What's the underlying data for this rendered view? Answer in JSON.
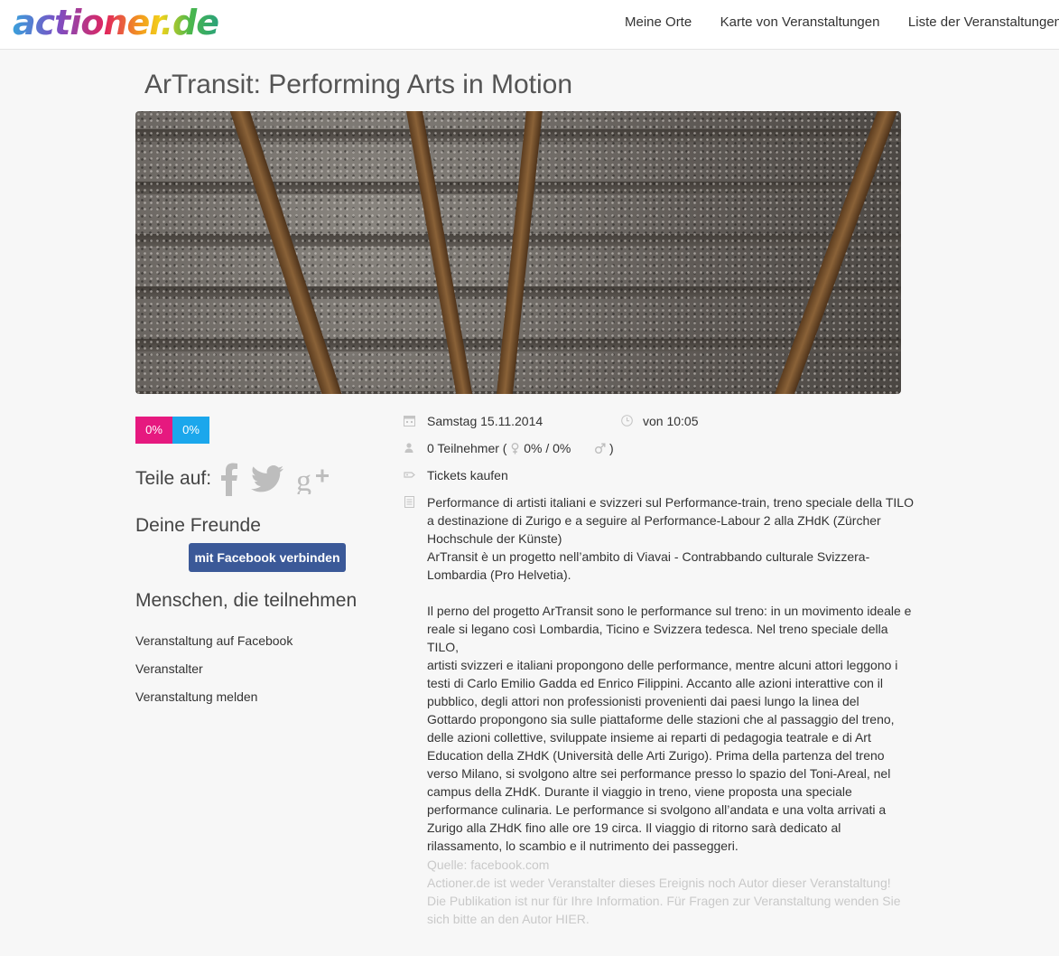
{
  "header": {
    "logo_text": "actioner.de",
    "nav": [
      "Meine Orte",
      "Karte von Veranstaltungen",
      "Liste der Veranstaltungen"
    ]
  },
  "event": {
    "title": "ArTransit: Performing Arts in Motion",
    "date": "Samstag 15.11.2014",
    "time": "von 10:05",
    "participants_count": "0 Teilnehmer (",
    "gender_ratio": "0% / 0%",
    "participants_close": ")",
    "tickets_label": "Tickets kaufen"
  },
  "stats": {
    "female_percent": "0%",
    "male_percent": "0%"
  },
  "share": {
    "label": "Teile auf:",
    "icons": [
      "facebook-icon",
      "twitter-icon",
      "google-plus-icon"
    ]
  },
  "friends": {
    "heading": "Deine Freunde",
    "connect_button": "mit Facebook verbinden"
  },
  "people_heading": "Menschen, die teilnehmen",
  "links": [
    "Veranstaltung auf Facebook",
    "Veranstalter",
    "Veranstaltung melden"
  ],
  "description": {
    "paragraph1_lines": [
      "Performance di artisti italiani e svizzeri sul Performance-train, treno speciale della TILO",
      "a destinazione di Zurigo e a seguire al Performance-Labour 2 alla ZHdK (Zürcher",
      "Hochschule der Künste)",
      "ArTransit è un progetto nell’ambito di Viavai - Contrabbando culturale Svizzera-",
      "Lombardia (Pro Helvetia)."
    ],
    "paragraph2_lines": [
      "Il perno del progetto ArTransit sono le performance sul treno: in un movimento ideale e",
      "reale si legano così Lombardia, Ticino e Svizzera tedesca. Nel treno speciale della TILO,",
      "artisti svizzeri e italiani propongono delle performance, mentre alcuni attori leggono i",
      "testi di Carlo Emilio Gadda ed Enrico Filippini. Accanto alle azioni interattive con il",
      "pubblico, degli attori non professionisti provenienti dai paesi lungo la linea del",
      "Gottardo propongono sia sulle piattaforme delle stazioni che al passaggio del treno,",
      "delle azioni collettive, sviluppate insieme ai reparti di pedagogia teatrale e di Art",
      "Education della ZHdK (Università delle Arti Zurigo). Prima della partenza del treno",
      "verso Milano, si svolgono altre sei performance presso lo spazio del Toni-Areal, nel",
      "campus della ZHdK. Durante il viaggio in treno, viene proposta una speciale",
      "performance culinaria. Le performance si svolgono all’andata e una volta arrivati a",
      "Zurigo alla ZHdK fino alle ore 19 circa. Il viaggio di ritorno sarà dedicato al",
      "rilassamento, lo scambio e il nutrimento dei passeggeri."
    ]
  },
  "source": {
    "lines": [
      "Quelle: facebook.com",
      "Actioner.de ist weder Veranstalter dieses Ereignis noch Autor dieser Veranstaltung!",
      "Die Publikation ist nur für Ihre Information. Für Fragen zur Veranstaltung wenden Sie",
      "sich bitte an den Autor HIER."
    ]
  },
  "colors": {
    "female": "#e6197f",
    "male": "#1ba7ec",
    "facebook_button": "#3b5998",
    "icon_gray": "#bdbdbd",
    "source_text": "#c9c9c9"
  }
}
